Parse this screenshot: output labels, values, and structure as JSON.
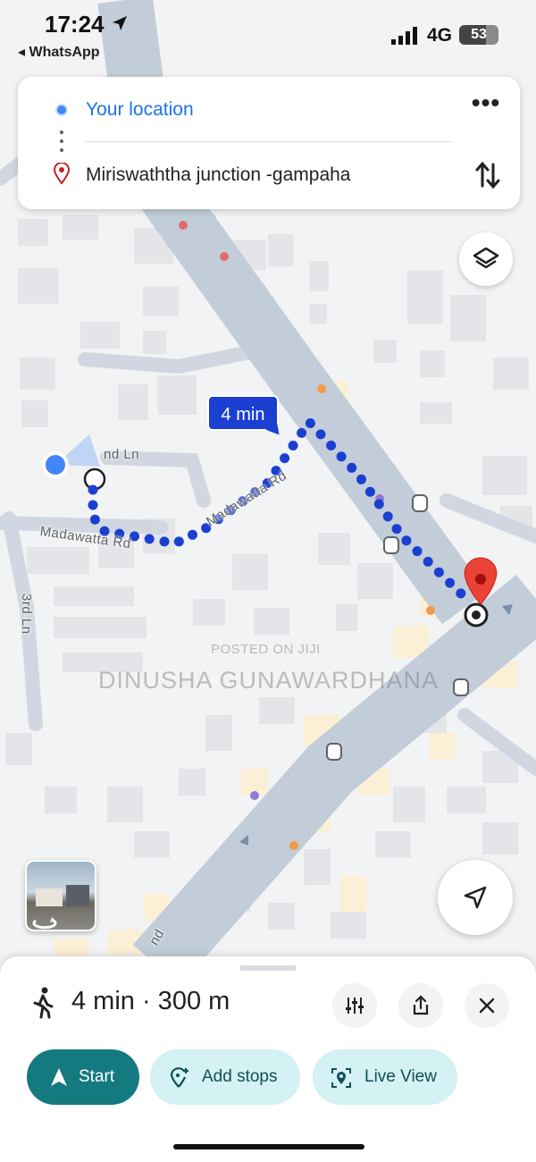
{
  "status_bar": {
    "time": "17:24",
    "back_app": "◂ WhatsApp",
    "network": "4G",
    "battery": "53"
  },
  "directions": {
    "origin": "Your location",
    "destination": "Miriswaththa junction -gampaha",
    "more": "•••"
  },
  "map": {
    "route_time": "4 min",
    "streets": {
      "madawatta_left": "Madawatta Rd",
      "madawatta_right": "Madawatta Rd",
      "lane_end": "nd Ln",
      "third_ln": "3rd Ln",
      "road_bottom": "nd"
    },
    "watermark_small": "POSTED ON JIJI",
    "watermark_large": "DINUSHA GUNAWARDHANA"
  },
  "bottom_sheet": {
    "summary": "4 min · 300 m",
    "start": "Start",
    "add_stops": "Add stops",
    "live_view": "Live View"
  },
  "colors": {
    "route": "#1a3fd1",
    "accent_teal": "#137a7f",
    "pin_red": "#ea4335"
  }
}
